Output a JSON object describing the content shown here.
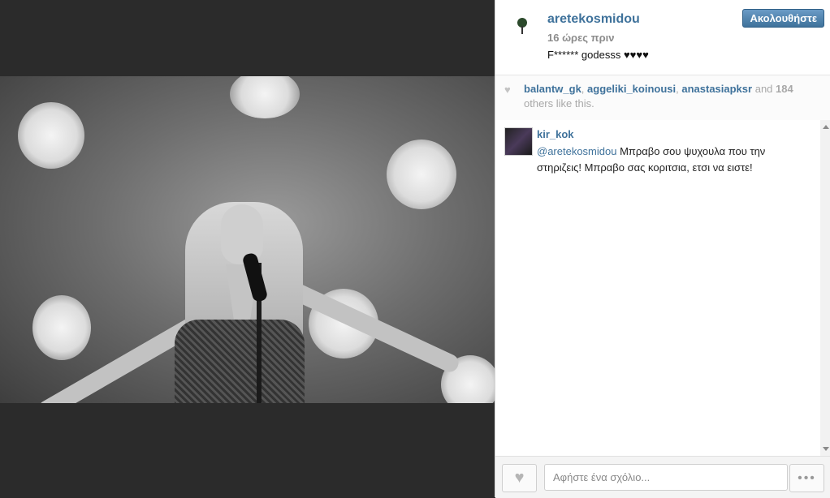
{
  "post": {
    "username": "aretekosmidou",
    "time_ago": "16 ώρες πριν",
    "caption": "F****** godesss ♥♥♥♥",
    "follow_label": "Ακολουθήστε"
  },
  "likes": {
    "users": [
      "balantw_gk",
      "aggeliki_koinousi",
      "anastasiapksr"
    ],
    "and_label": "and",
    "count": "184",
    "suffix": "others like this."
  },
  "comments": [
    {
      "username": "kir_kok",
      "mention": "@aretekosmidou",
      "text": " Μπραβο σου ψυχουλα που την στηριζεις! Μπραβο σας κοριτσια, ετσι να ειστε!"
    }
  ],
  "footer": {
    "comment_placeholder": "Αφήστε ένα σχόλιο...",
    "like_icon": "heart-icon",
    "more_icon": "ellipsis-icon"
  },
  "colors": {
    "link": "#3f729b",
    "follow_button": "#3f729b"
  }
}
